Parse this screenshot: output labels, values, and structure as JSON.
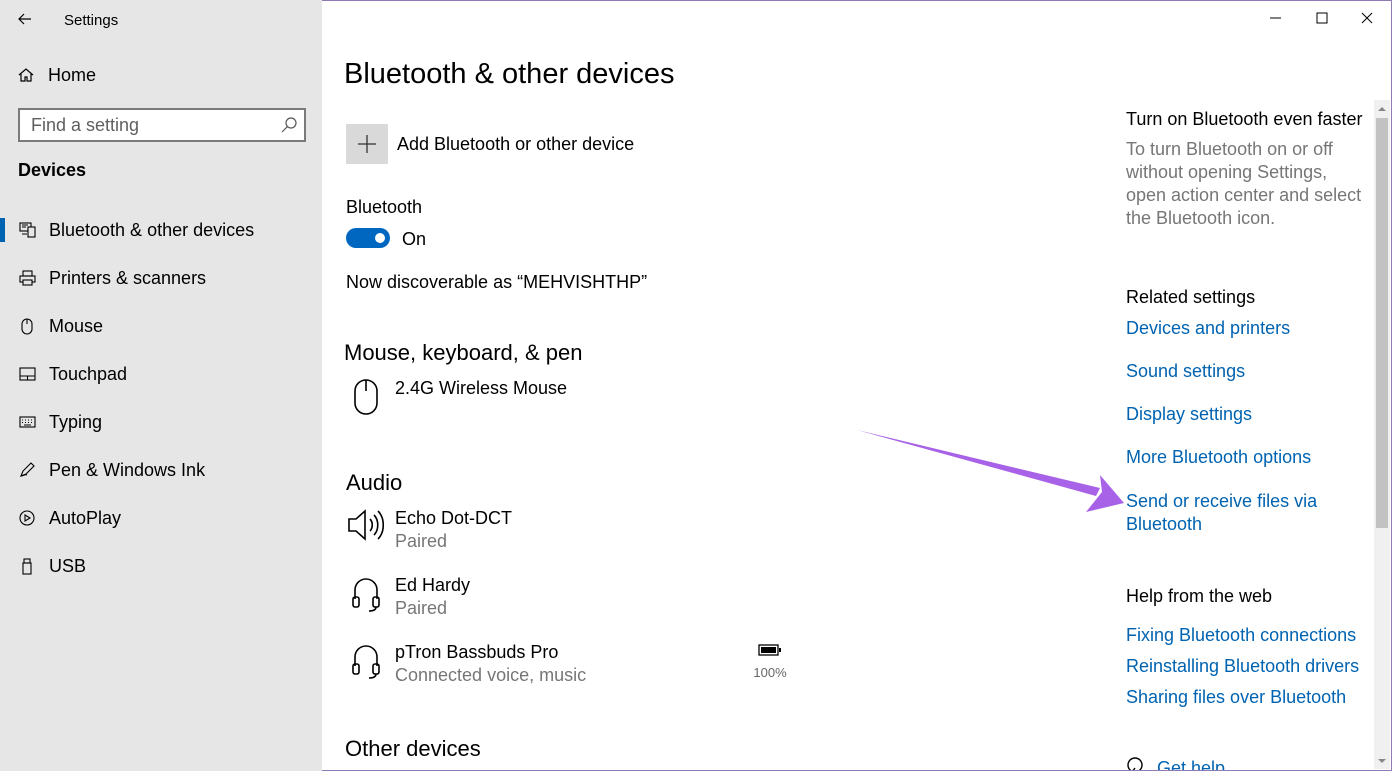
{
  "window": {
    "title": "Settings",
    "back_icon": "back-arrow-icon",
    "controls": [
      "minimize-icon",
      "maximize-icon",
      "close-icon"
    ]
  },
  "sidebar": {
    "home_label": "Home",
    "search_placeholder": "Find a setting",
    "section_title": "Devices",
    "items": [
      {
        "label": "Bluetooth & other devices",
        "icon": "bluetooth-devices-icon",
        "active": true
      },
      {
        "label": "Printers & scanners",
        "icon": "printer-icon",
        "active": false
      },
      {
        "label": "Mouse",
        "icon": "mouse-icon",
        "active": false
      },
      {
        "label": "Touchpad",
        "icon": "touchpad-icon",
        "active": false
      },
      {
        "label": "Typing",
        "icon": "keyboard-icon",
        "active": false
      },
      {
        "label": "Pen & Windows Ink",
        "icon": "pen-icon",
        "active": false
      },
      {
        "label": "AutoPlay",
        "icon": "autoplay-icon",
        "active": false
      },
      {
        "label": "USB",
        "icon": "usb-icon",
        "active": false
      }
    ]
  },
  "main": {
    "title": "Bluetooth & other devices",
    "add_device_label": "Add Bluetooth or other device",
    "bluetooth_label": "Bluetooth",
    "bluetooth_state": "On",
    "discoverable_text": "Now discoverable as “MEHVISHTHP”",
    "groups": {
      "mouse_keyboard_pen": {
        "title": "Mouse, keyboard, & pen",
        "devices": [
          {
            "name": "2.4G Wireless Mouse",
            "status": "",
            "icon": "mouse-icon"
          }
        ]
      },
      "audio": {
        "title": "Audio",
        "devices": [
          {
            "name": "Echo Dot-DCT",
            "status": "Paired",
            "icon": "speaker-icon"
          },
          {
            "name": "Ed Hardy",
            "status": "Paired",
            "icon": "headphones-icon"
          },
          {
            "name": "pTron Bassbuds Pro",
            "status": "Connected voice, music",
            "icon": "headphones-icon",
            "battery": "100%"
          }
        ]
      },
      "other": {
        "title": "Other devices"
      }
    }
  },
  "right_panel": {
    "tip_title": "Turn on Bluetooth even faster",
    "tip_text": "To turn Bluetooth on or off without opening Settings, open action center and select the Bluetooth icon.",
    "related_title": "Related settings",
    "related_links": [
      "Devices and printers",
      "Sound settings",
      "Display settings",
      "More Bluetooth options",
      "Send or receive files via Bluetooth"
    ],
    "help_title": "Help from the web",
    "help_links": [
      "Fixing Bluetooth connections",
      "Reinstalling Bluetooth drivers",
      "Sharing files over Bluetooth"
    ],
    "get_help": "Get help"
  },
  "annotation": {
    "arrow_color": "#a862e8"
  },
  "colors": {
    "accent": "#0063b1",
    "sidebar_bg": "#e6e6e6",
    "toggle_on": "#0067c0",
    "secondary_text": "#767676"
  }
}
